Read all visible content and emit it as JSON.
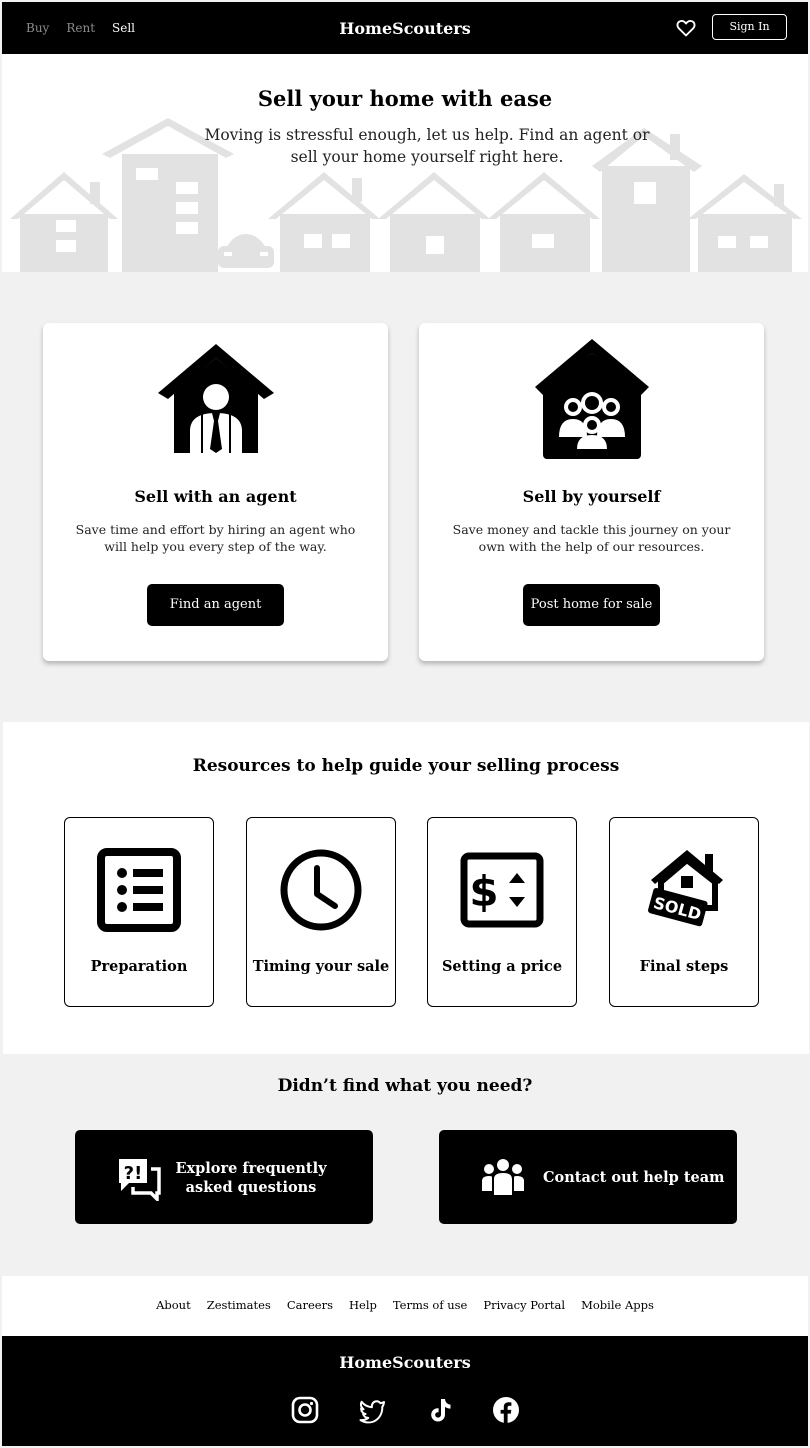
{
  "nav": {
    "links": [
      "Buy",
      "Rent",
      "Sell"
    ],
    "active": "Sell",
    "brand": "HomeScouters",
    "favorites_icon": "heart-icon",
    "signin_label": "Sign In"
  },
  "hero": {
    "title": "Sell your home with ease",
    "subtitle": "Moving is stressful enough, let us help. Find an agent or sell your home yourself right here."
  },
  "sell_options": [
    {
      "icon": "agent-house-icon",
      "title": "Sell with an agent",
      "description": "Save time and effort by hiring an agent who will help you every step of the way.",
      "button": "Find an agent"
    },
    {
      "icon": "family-house-icon",
      "title": "Sell by yourself",
      "description": "Save money and tackle this journey on your own with the help of our resources.",
      "button": "Post home for sale"
    }
  ],
  "resources": {
    "title": "Resources to help guide your selling process",
    "items": [
      {
        "label": "Preparation",
        "icon": "checklist-icon"
      },
      {
        "label": "Timing your sale",
        "icon": "clock-icon"
      },
      {
        "label": "Setting a price",
        "icon": "price-tag-icon"
      },
      {
        "label": "Final steps",
        "icon": "sold-sign-icon"
      }
    ]
  },
  "help": {
    "title": "Didn’t find what you need?",
    "faq_label_line1": "Explore frequently",
    "faq_label_line2": "asked questions",
    "faq_icon": "faq-chat-icon",
    "contact_label": "Contact out help team",
    "contact_icon": "team-icon"
  },
  "footer_links": [
    "About",
    "Zestimates",
    "Careers",
    "Help",
    "Terms of use",
    "Privacy Portal",
    "Mobile Apps"
  ],
  "footer": {
    "brand": "HomeScouters",
    "social": [
      "instagram-icon",
      "twitter-icon",
      "tiktok-icon",
      "facebook-icon"
    ]
  }
}
